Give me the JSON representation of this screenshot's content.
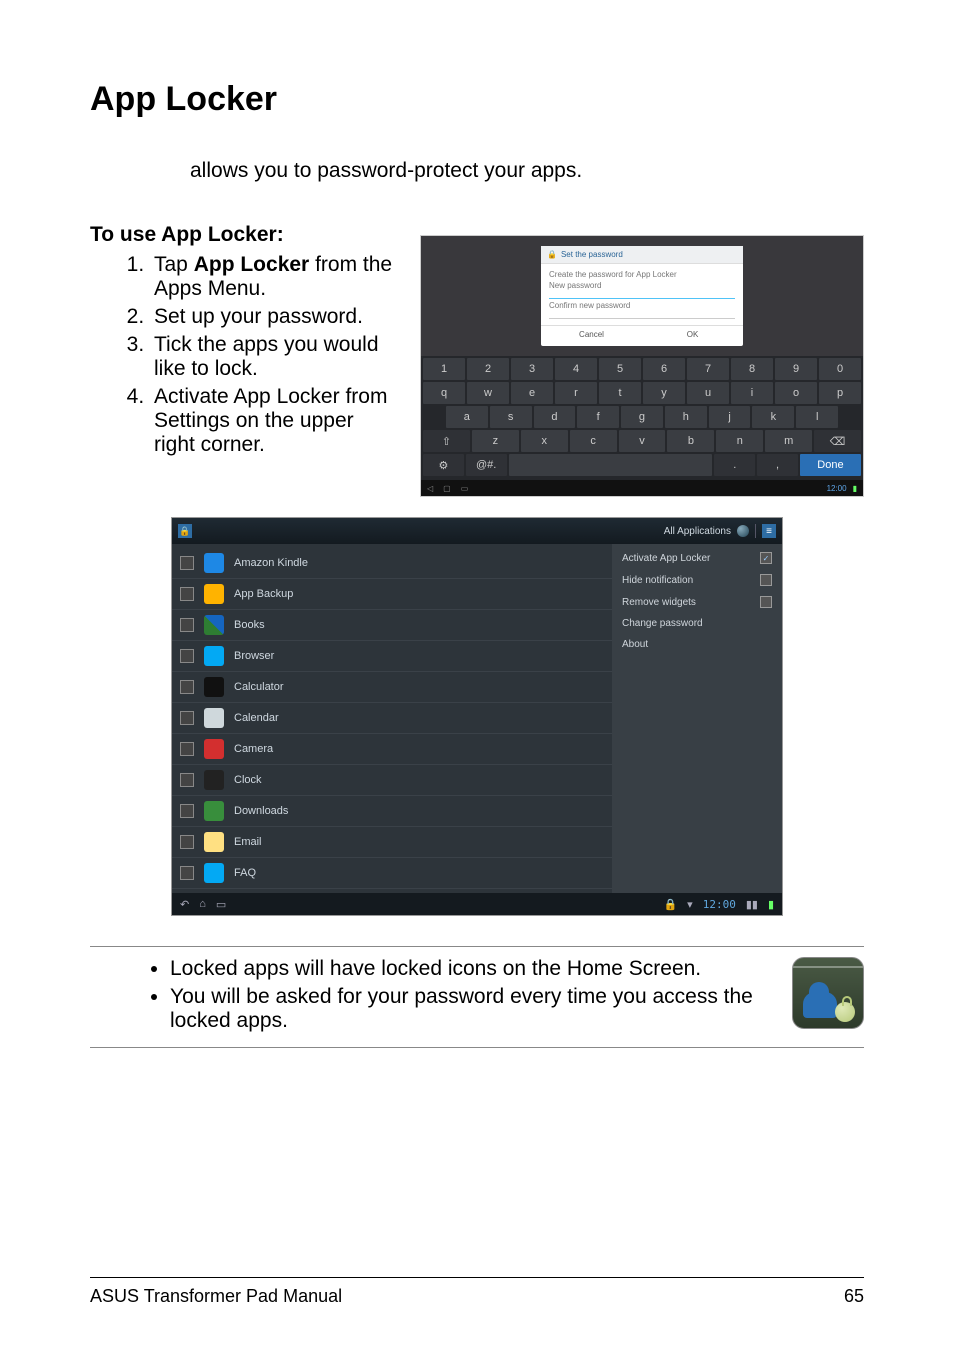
{
  "title": "App Locker",
  "intro": "allows you to password-protect your apps.",
  "subhead": "To use App Locker:",
  "steps": [
    {
      "prefix": "Tap ",
      "bold": "App Locker",
      "suffix": " from the Apps Menu."
    },
    {
      "text": "Set up your password."
    },
    {
      "text": "Tick the apps you would like to lock."
    },
    {
      "text": "Activate App Locker from Settings on the upper right corner."
    }
  ],
  "dialog": {
    "title": "Set the password",
    "line1": "Create the password for App Locker",
    "line2": "New password",
    "line3": "Confirm new password",
    "cancel": "Cancel",
    "ok": "OK"
  },
  "keyboard": {
    "row1": [
      "1",
      "2",
      "3",
      "4",
      "5",
      "6",
      "7",
      "8",
      "9",
      "0"
    ],
    "row2": [
      "q",
      "w",
      "e",
      "r",
      "t",
      "y",
      "u",
      "i",
      "o",
      "p"
    ],
    "row3": [
      "a",
      "s",
      "d",
      "f",
      "g",
      "h",
      "j",
      "k",
      "l"
    ],
    "row4": [
      "⇧",
      "z",
      "x",
      "c",
      "v",
      "b",
      "n",
      "m",
      "⌫"
    ],
    "row5": {
      "gear": "⚙",
      "sym": "@#.",
      "space": "",
      "dot": ".",
      "comma": ",",
      "done": "Done"
    },
    "clock": "12:00"
  },
  "list": {
    "header_title": "All Applications",
    "menu": [
      {
        "label": "Activate App Locker",
        "checked": true
      },
      {
        "label": "Hide notification",
        "checked": false
      },
      {
        "label": "Remove widgets",
        "checked": false
      },
      {
        "label": "Change password",
        "noswitch": true
      },
      {
        "label": "About",
        "noswitch": true
      }
    ],
    "apps": [
      {
        "name": "Amazon Kindle",
        "icon": "kindle"
      },
      {
        "name": "App Backup",
        "icon": "backup"
      },
      {
        "name": "Books",
        "icon": "books"
      },
      {
        "name": "Browser",
        "icon": "browser"
      },
      {
        "name": "Calculator",
        "icon": "calc"
      },
      {
        "name": "Calendar",
        "icon": "calendar"
      },
      {
        "name": "Camera",
        "icon": "camera"
      },
      {
        "name": "Clock",
        "icon": "clock"
      },
      {
        "name": "Downloads",
        "icon": "downloads"
      },
      {
        "name": "Email",
        "icon": "email"
      },
      {
        "name": "FAQ",
        "icon": "faq"
      }
    ],
    "clock": "12:00"
  },
  "notes": [
    "Locked apps will have locked icons on the Home Screen.",
    "You will be asked for your password every time you access the locked apps."
  ],
  "footer": {
    "left": "ASUS Transformer Pad Manual",
    "right": "65"
  }
}
